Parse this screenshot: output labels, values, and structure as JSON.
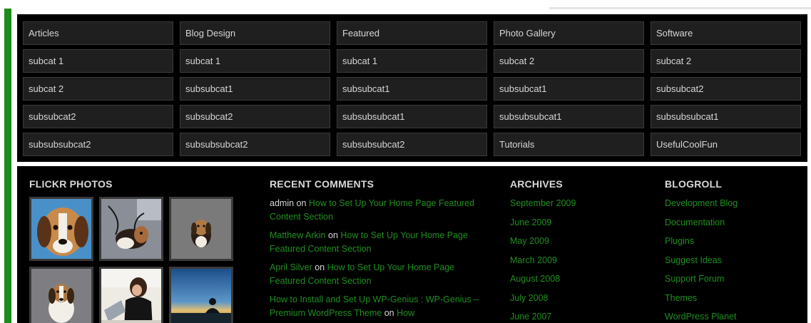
{
  "categories": [
    [
      "Articles",
      "Blog Design",
      "Featured",
      "Photo Gallery",
      "Software"
    ],
    [
      "subcat 1",
      "subcat 1",
      "subcat 1",
      "subcat 2",
      "subcat 2"
    ],
    [
      "subcat 2",
      "subsubcat1",
      "subsubcat1",
      "subsubcat1",
      "subsubcat2"
    ],
    [
      "subsubcat2",
      "subsubcat2",
      "subsubsubcat1",
      "subsubsubcat1",
      "subsubsubcat1"
    ],
    [
      "subsubsubcat2",
      "subsubsubcat2",
      "subsubsubcat2",
      "Tutorials",
      "UsefulCoolFun"
    ]
  ],
  "flickr": {
    "title": "FLICKR PHOTOS",
    "photos": [
      "beagle-closeup",
      "beagle-on-floor",
      "beagle-puppy-sitting",
      "beagle-sitting",
      "woman-at-laptop",
      "meditation-at-sunset"
    ]
  },
  "recent_comments": {
    "title": "RECENT COMMENTS",
    "items": [
      {
        "author": "admin",
        "sep": " on ",
        "post": "How to Set Up Your Home Page Featured Content Section",
        "author_is_link": false
      },
      {
        "author": "Matthew Arkin",
        "sep": " on ",
        "post": "How to Set Up Your Home Page Featured Content Section",
        "author_is_link": true
      },
      {
        "author": "April Silver",
        "sep": " on ",
        "post": "How to Set Up Your Home Page Featured Content Section",
        "author_is_link": true
      },
      {
        "author": "How to Install and Set Up WP-Genius : WP-Genius – Premium WordPress Theme",
        "sep": " on ",
        "post": "How",
        "author_is_link": true
      }
    ]
  },
  "archives": {
    "title": "ARCHIVES",
    "items": [
      "September 2009",
      "June 2009",
      "May 2009",
      "March 2009",
      "August 2008",
      "July 2008",
      "June 2007"
    ]
  },
  "blogroll": {
    "title": "BLOGROLL",
    "items": [
      "Development Blog",
      "Documentation",
      "Plugins",
      "Suggest Ideas",
      "Support Forum",
      "Themes",
      "WordPress Planet"
    ]
  },
  "colors": {
    "accent_green": "#1f8f1f",
    "panel_bg": "#000000",
    "cell_bg": "#1f1f1f",
    "side_bar": "#1a8c1a"
  }
}
